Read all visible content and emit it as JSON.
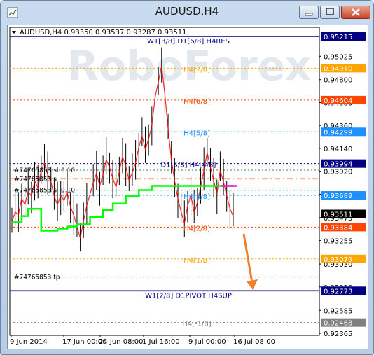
{
  "window": {
    "title": "AUDUSD,H4",
    "buttons": {
      "minimize": "minimize-icon",
      "maximize": "maximize-icon",
      "close": "close-icon"
    }
  },
  "symbol_info": "AUDUSD,H4  0.93350 0.93537 0.93287 0.93511",
  "watermark": "RoboForex",
  "colors": {
    "background": "#ffffff",
    "plot_area": "#ffffff",
    "bars": "#000000",
    "red_line": "#ff0000",
    "green_line": "#00ff00",
    "navy": "#000080",
    "orange": "#ffa500",
    "orangered": "#ff4500",
    "dodgerblue": "#1e90ff",
    "magenta": "#ff00ff",
    "arrow": "#f07f2e"
  },
  "chart_data": {
    "type": "line",
    "symbol": "AUDUSD",
    "timeframe": "H4",
    "ohlc": {
      "open": 0.9335,
      "high": 0.93537,
      "low": 0.93287,
      "close": 0.93511
    },
    "y_ticks": [
      "0.95025",
      "0.94800",
      "0.94580",
      "0.94360",
      "0.94140",
      "0.93920",
      "0.93700",
      "0.93475",
      "0.93255",
      "0.93030",
      "0.92810",
      "0.92585",
      "0.92365"
    ],
    "x_ticks": [
      "9 Jun 2014",
      "17 Jun 00:00",
      "24 Jun 08:00",
      "1 Jul 16:00",
      "9 Jul 00:00",
      "16 Jul 08:00"
    ],
    "price_tags": [
      {
        "value": 0.95215,
        "label": "0.95215",
        "color": "#000080"
      },
      {
        "value": 0.9491,
        "label": "0.94910",
        "color": "#ffa500"
      },
      {
        "value": 0.94604,
        "label": "0.94604",
        "color": "#ff4500"
      },
      {
        "value": 0.94299,
        "label": "0.94299",
        "color": "#1e90ff"
      },
      {
        "value": 0.93994,
        "label": "0.93994",
        "color": "#000080"
      },
      {
        "value": 0.93689,
        "label": "0.93689",
        "color": "#1e90ff"
      },
      {
        "value": 0.93511,
        "label": "0.93511",
        "color": "#000000"
      },
      {
        "value": 0.93384,
        "label": "0.93384",
        "color": "#ff4500"
      },
      {
        "value": 0.93079,
        "label": "0.93079",
        "color": "#ffa500"
      },
      {
        "value": 0.92773,
        "label": "0.92773",
        "color": "#000080"
      },
      {
        "value": 0.92468,
        "label": "0.92468",
        "color": "#808080"
      }
    ],
    "level_labels": [
      {
        "text": "W1[3/8] D1[6/8] H4RES",
        "value": 0.95215,
        "color": "#000080"
      },
      {
        "text": "H4[7/8]",
        "value": 0.9491,
        "color": "#ffa500"
      },
      {
        "text": "H4[6/8]",
        "value": 0.94604,
        "color": "#ff4500"
      },
      {
        "text": "H4[5/8]",
        "value": 0.94299,
        "color": "#1e90ff"
      },
      {
        "text": "D1[5/8] H4[4/8]",
        "value": 0.93994,
        "color": "#000080"
      },
      {
        "text": "H4[3/8]",
        "value": 0.93689,
        "color": "#1e90ff"
      },
      {
        "text": "H4[2/8]",
        "value": 0.93384,
        "color": "#ff4500"
      },
      {
        "text": "H4[1/8]",
        "value": 0.93079,
        "color": "#ffa500"
      },
      {
        "text": "W1[2/8] D1PIVOT H4SUP",
        "value": 0.92773,
        "color": "#000080"
      },
      {
        "text": "H4[-1/8]",
        "value": 0.92468,
        "color": "#808080"
      }
    ],
    "order_labels": [
      {
        "text": "#74765853 sl",
        "value": 0.93931
      },
      {
        "text": "#74765853 s",
        "value": 0.93848
      },
      {
        "text": "#74765853 sl",
        "value": 0.93738
      },
      {
        "text": "#74765853 tp",
        "value": 0.92905
      }
    ],
    "order_values": [
      {
        "text": "0.10",
        "value": 0.93931
      },
      {
        "text": "0.10",
        "value": 0.93738
      }
    ],
    "series": [
      {
        "values": [
          0.9345,
          0.9355,
          0.9352,
          0.9368,
          0.9362,
          0.9375,
          0.937,
          0.9385,
          0.9378,
          0.9395,
          0.9402,
          0.9391,
          0.9384,
          0.937,
          0.9362,
          0.9371,
          0.9366,
          0.9374,
          0.936,
          0.9352,
          0.9341,
          0.933,
          0.9346,
          0.9361,
          0.9372,
          0.9383,
          0.9392,
          0.938,
          0.9391,
          0.9405,
          0.9398,
          0.9387,
          0.9379,
          0.9394,
          0.9408,
          0.9399,
          0.9385,
          0.9393,
          0.9402,
          0.9417,
          0.9428,
          0.9415,
          0.9425,
          0.9438,
          0.9465,
          0.948,
          0.9495,
          0.9468,
          0.9435,
          0.9405,
          0.9385,
          0.9368,
          0.9355,
          0.9344,
          0.9361,
          0.9371,
          0.9354,
          0.9364,
          0.9379,
          0.9395,
          0.9412,
          0.9398,
          0.9385,
          0.9372,
          0.9395,
          0.9384,
          0.9371,
          0.9358,
          0.9351
        ]
      },
      {
        "name": "",
        "values": [
          0.9343,
          0.9343,
          0.9343,
          0.9349,
          0.9349,
          0.9356,
          0.9356,
          0.9356,
          0.9356,
          0.9335,
          0.9335,
          0.9335,
          0.9335,
          0.9335,
          0.9337,
          0.9337,
          0.9337,
          0.9339,
          0.9339,
          0.9339,
          0.9341,
          0.9341,
          0.9341,
          0.9341,
          0.9348,
          0.9348,
          0.9348,
          0.9348,
          0.9355,
          0.9355,
          0.9355,
          0.9361,
          0.9361,
          0.9361,
          0.9361,
          0.9368,
          0.9368,
          0.9368,
          0.9368,
          0.9374,
          0.9374,
          0.9374,
          0.9374,
          0.9378,
          0.9378,
          0.9378,
          0.9378,
          0.9378,
          0.9378,
          0.9378,
          0.9378,
          0.9378,
          0.9378,
          0.9378,
          0.9378,
          0.9378,
          0.9378,
          0.9378,
          0.9378,
          0.9378,
          0.9378,
          0.9378,
          0.9378,
          0.9378,
          0.9378,
          0.9378,
          0.9378,
          0.9378,
          0.9378
        ]
      }
    ]
  }
}
